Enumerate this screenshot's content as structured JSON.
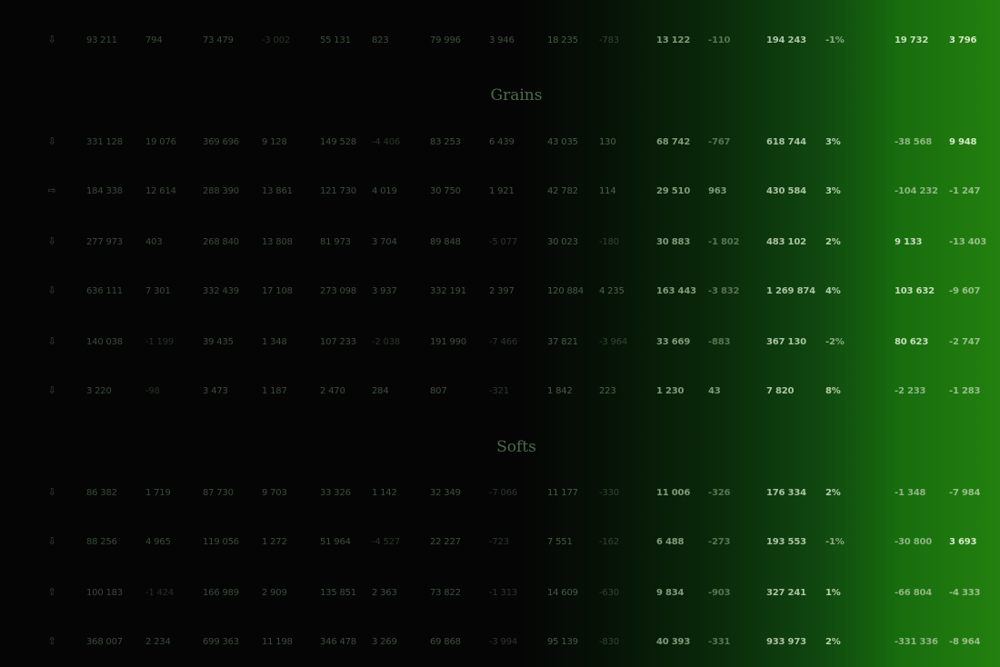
{
  "columns": [
    "c1",
    "c2",
    "c3",
    "c4",
    "c5",
    "c6",
    "c7",
    "c8",
    "c9",
    "c10",
    "c11",
    "c12",
    "c13",
    "c14",
    "c15",
    "c16"
  ],
  "sections": [
    {
      "title": ""
    },
    {
      "title": "Grains"
    },
    {
      "title": "Softs"
    }
  ],
  "rows": [
    {
      "arrow": "⇩",
      "values": [
        "93 211",
        "794",
        "73 479",
        "-3 002",
        "55 131",
        "823",
        "79 996",
        "3 946",
        "18 235",
        "-783",
        "13 122",
        "-110",
        "194 243",
        "-1%",
        "19 732",
        "3 796"
      ]
    },
    {
      "arrow": "⇩",
      "values": [
        "331 128",
        "19 076",
        "369 696",
        "9 128",
        "149 528",
        "-4 406",
        "83 253",
        "6 439",
        "43 035",
        "130",
        "68 742",
        "-767",
        "618 744",
        "3%",
        "-38 568",
        "9 948"
      ]
    },
    {
      "arrow": "⇨",
      "values": [
        "184 338",
        "12 614",
        "288 390",
        "13 861",
        "121 730",
        "4 019",
        "30 750",
        "1 921",
        "42 782",
        "114",
        "29 510",
        "963",
        "430 584",
        "3%",
        "-104 232",
        "-1 247"
      ]
    },
    {
      "arrow": "⇩",
      "values": [
        "277 973",
        "403",
        "268 840",
        "13 808",
        "81 973",
        "3 704",
        "89 848",
        "-5 077",
        "30 023",
        "-180",
        "30 883",
        "-1 802",
        "483 102",
        "2%",
        "9 133",
        "-13 403"
      ]
    },
    {
      "arrow": "⇩",
      "values": [
        "636 111",
        "7 301",
        "332 439",
        "17 108",
        "273 098",
        "3 937",
        "332 191",
        "2 397",
        "120 884",
        "4 235",
        "163 443",
        "-3 832",
        "1 269 874",
        "4%",
        "103 632",
        "-9 607"
      ]
    },
    {
      "arrow": "⇩",
      "values": [
        "140 038",
        "-1 199",
        "39 435",
        "1 348",
        "107 233",
        "-2 038",
        "191 990",
        "-7 466",
        "37 821",
        "-3 964",
        "33 669",
        "-883",
        "367 130",
        "-2%",
        "80 623",
        "-2 747"
      ]
    },
    {
      "arrow": "⇩",
      "values": [
        "3 220",
        "-98",
        "3 473",
        "1 187",
        "2 470",
        "284",
        "807",
        "-321",
        "1 842",
        "223",
        "1 230",
        "43",
        "7 820",
        "8%",
        "-2 233",
        "-1 283"
      ]
    },
    {
      "arrow": "⇩",
      "values": [
        "86 382",
        "1 719",
        "87 730",
        "9 703",
        "33 326",
        "1 142",
        "32 349",
        "-7 066",
        "11 177",
        "-330",
        "11 006",
        "-326",
        "176 334",
        "2%",
        "-1 348",
        "-7 984"
      ]
    },
    {
      "arrow": "⇩",
      "values": [
        "88 256",
        "4 965",
        "119 056",
        "1 272",
        "51 964",
        "-4 527",
        "22 227",
        "-723",
        "7 551",
        "-162",
        "6 488",
        "-273",
        "193 553",
        "-1%",
        "-30 800",
        "3 693"
      ]
    },
    {
      "arrow": "⇧",
      "values": [
        "100 183",
        "-1 424",
        "166 989",
        "2 909",
        "135 851",
        "2 363",
        "73 822",
        "-1 313",
        "14 609",
        "-630",
        "9 834",
        "-903",
        "327 241",
        "1%",
        "-66 804",
        "-4 333"
      ]
    },
    {
      "arrow": "⇧",
      "values": [
        "368 007",
        "2 234",
        "699 363",
        "11 198",
        "346 478",
        "3 269",
        "69 868",
        "-3 994",
        "95 139",
        "-830",
        "40 393",
        "-331",
        "933 973",
        "2%",
        "-331 336",
        "-8 964"
      ]
    }
  ]
}
